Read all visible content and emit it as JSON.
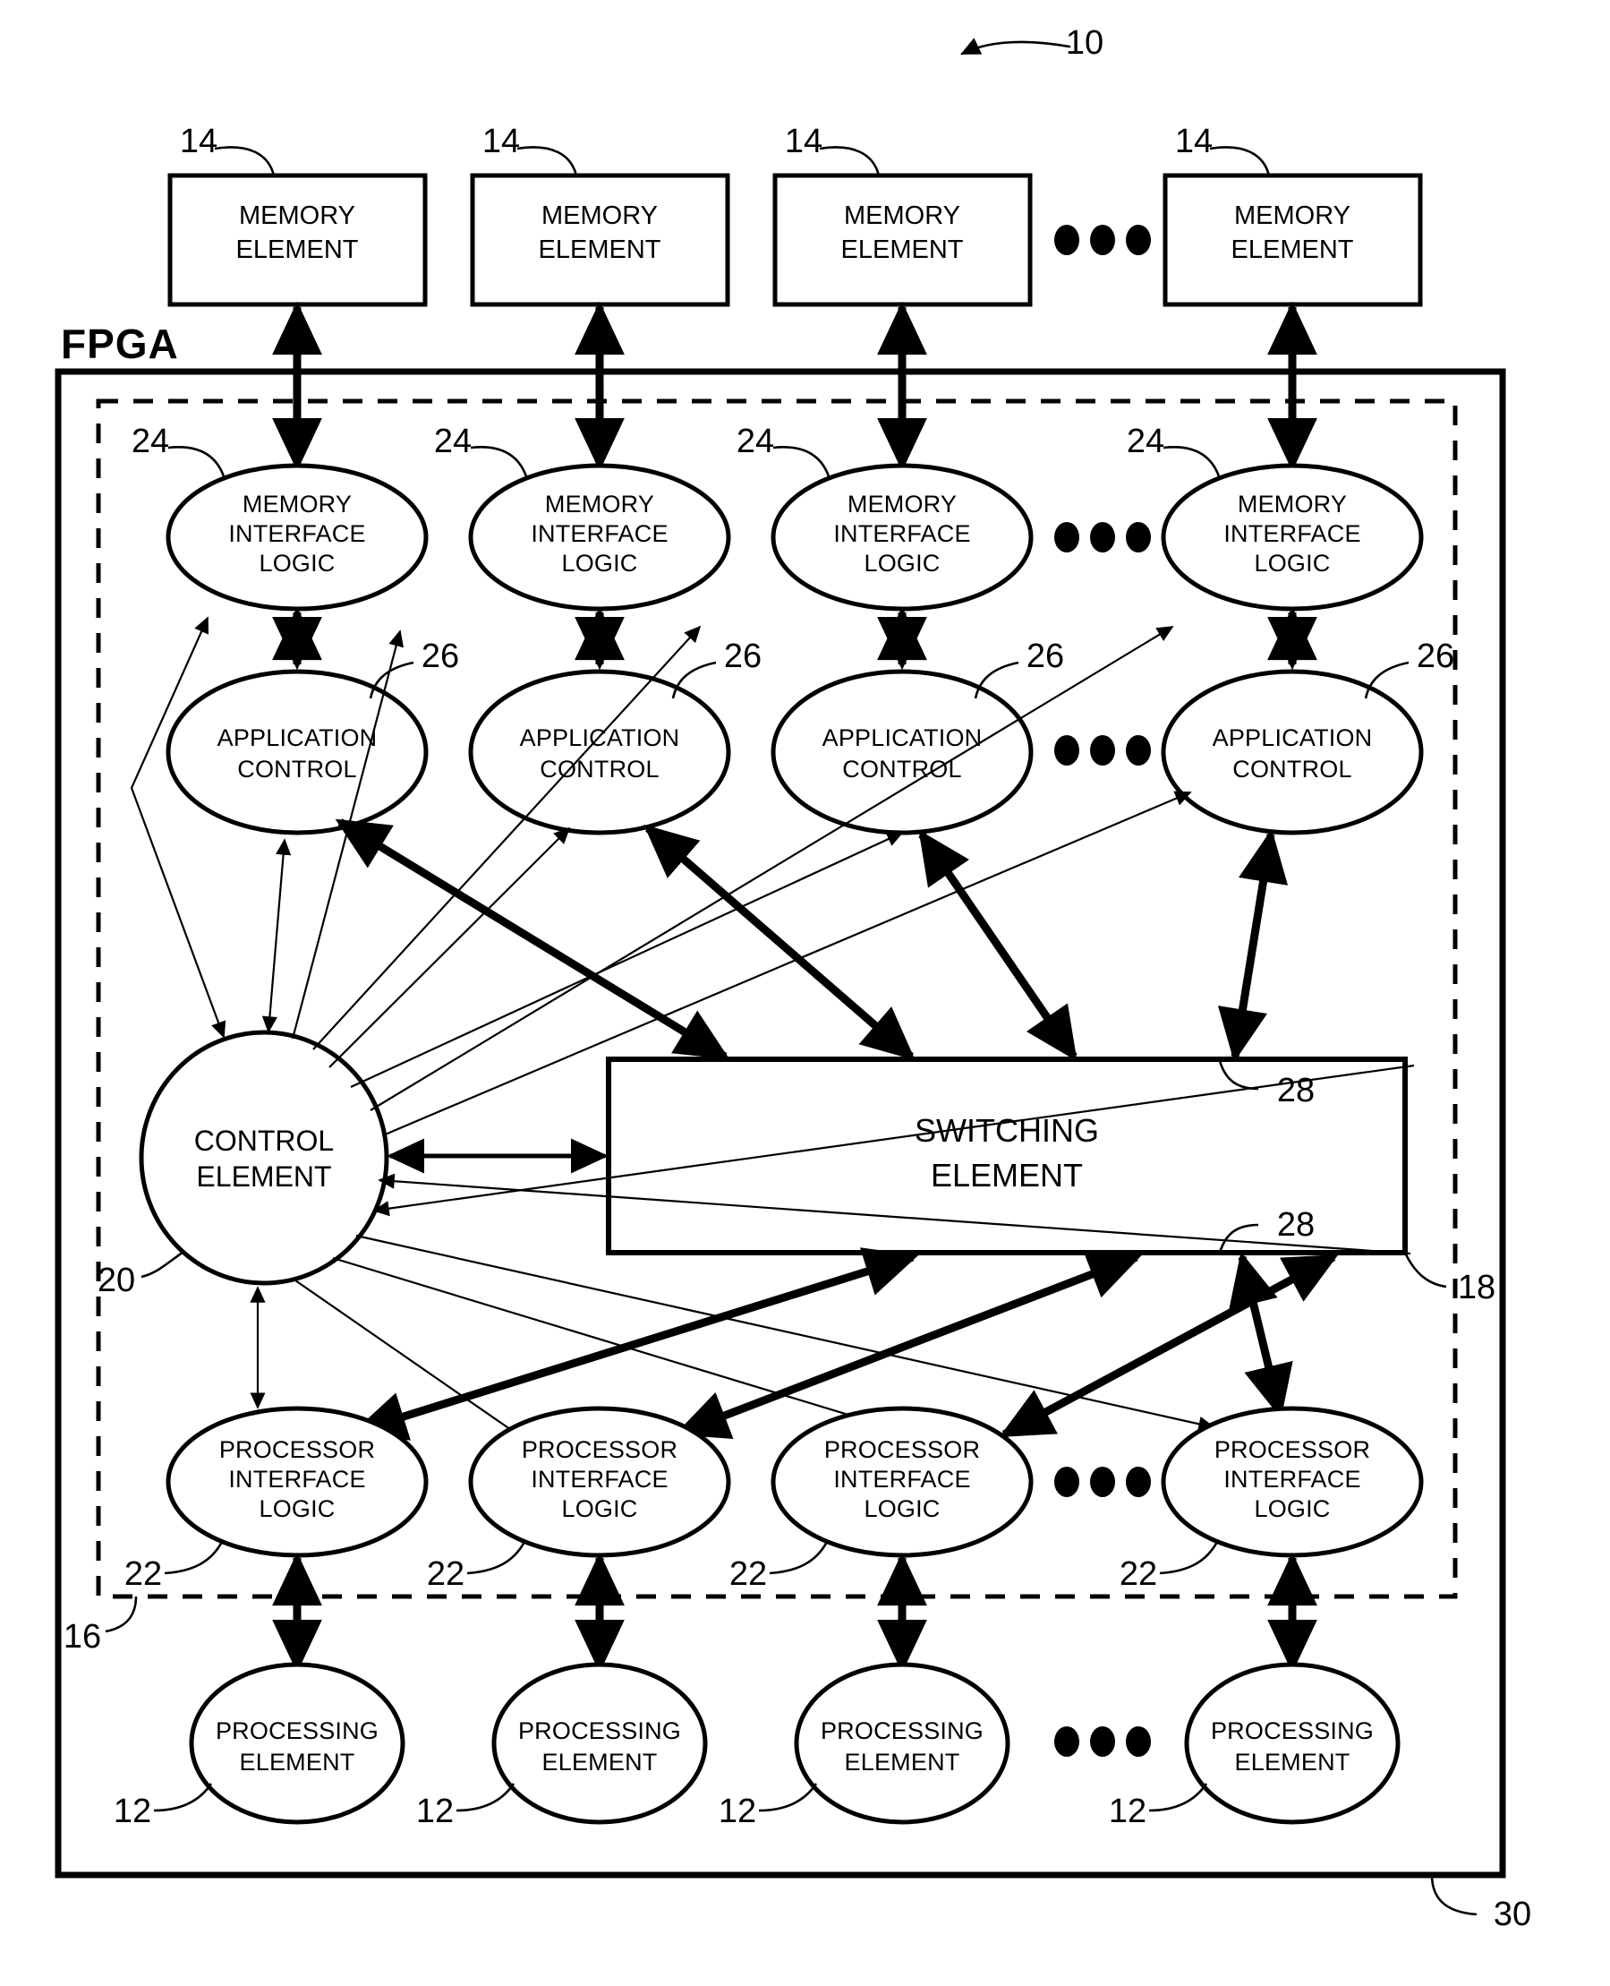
{
  "figure": {
    "figure_ref": "10",
    "fpga_label": "FPGA",
    "chip_ref": "30",
    "inner_dashed_ref": "16",
    "switching_element": {
      "line1": "SWITCHING",
      "line2": "ELEMENT",
      "ref": "18",
      "port_ref_top": "28",
      "port_ref_bottom": "28"
    },
    "control_element": {
      "line1": "CONTROL",
      "line2": "ELEMENT",
      "ref": "20"
    },
    "ellipsis": "•••",
    "rows": [
      {
        "name": "memory-elements",
        "ref": "14",
        "shape": "rect",
        "lines": [
          "MEMORY",
          "ELEMENT"
        ],
        "count": 4,
        "has_ellipsis": true
      },
      {
        "name": "memory-interface-logic",
        "ref": "24",
        "shape": "ellipse",
        "lines": [
          "MEMORY",
          "INTERFACE",
          "LOGIC"
        ],
        "count": 4,
        "has_ellipsis": true
      },
      {
        "name": "application-control",
        "ref": "26",
        "shape": "ellipse",
        "lines": [
          "APPLICATION",
          "CONTROL"
        ],
        "count": 4,
        "has_ellipsis": true
      },
      {
        "name": "processor-interface-logic",
        "ref": "22",
        "shape": "ellipse",
        "lines": [
          "PROCESSOR",
          "INTERFACE",
          "LOGIC"
        ],
        "count": 4,
        "has_ellipsis": true
      },
      {
        "name": "processing-elements",
        "ref": "12",
        "shape": "ellipse",
        "lines": [
          "PROCESSING",
          "ELEMENT"
        ],
        "count": 4,
        "has_ellipsis": true
      }
    ],
    "colors": {
      "ink": "#000000",
      "paper": "#ffffff"
    }
  }
}
